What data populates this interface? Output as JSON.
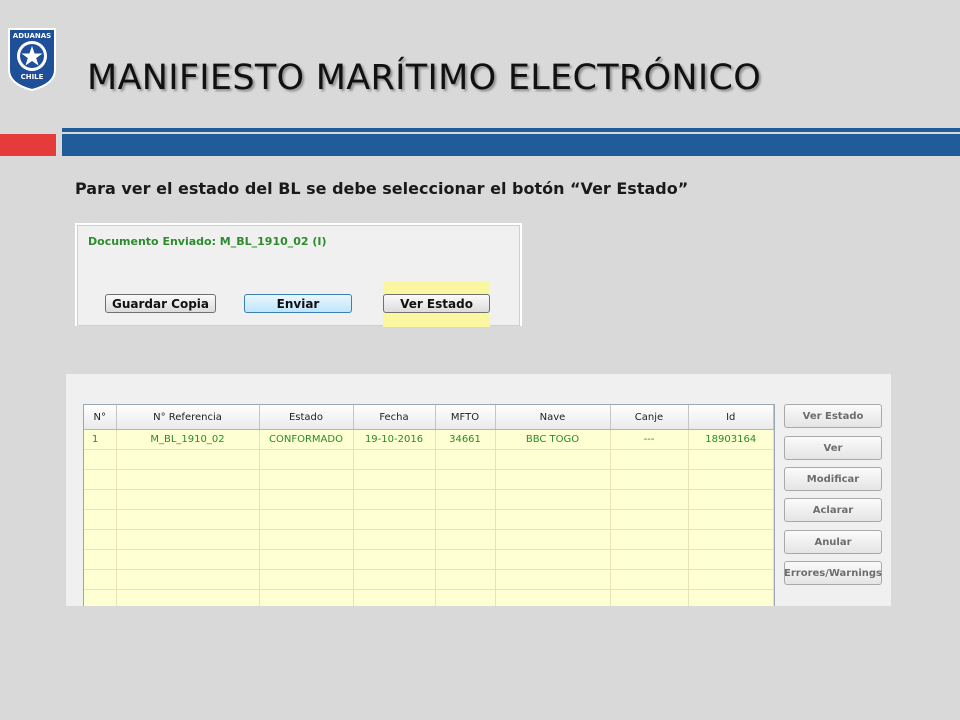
{
  "logo": {
    "top_text": "ADUANAS",
    "bottom_text": "CHILE"
  },
  "title": "MANIFIESTO MARÍTIMO ELECTRÓNICO",
  "instruction": "Para ver el estado del BL se debe seleccionar el botón “Ver Estado”",
  "colors": {
    "accent_red": "#e63b3b",
    "accent_blue": "#1f5c99",
    "highlight": "#fbf7a0",
    "row_green": "#2a8a2a"
  },
  "form": {
    "doc_label": "Documento Enviado:  M_BL_1910_02 (I)",
    "buttons": {
      "guardar": "Guardar Copia",
      "enviar": "Enviar",
      "ver_estado": "Ver Estado"
    }
  },
  "table": {
    "headers": [
      "N°",
      "N° Referencia",
      "Estado",
      "Fecha",
      "MFTO",
      "Nave",
      "Canje",
      "Id"
    ],
    "row": [
      "1",
      "M_BL_1910_02",
      "CONFORMADO",
      "19-10-2016",
      "34661",
      "BBC TOGO",
      "---",
      "18903164"
    ]
  },
  "side_buttons": [
    "Ver Estado",
    "Ver",
    "Modificar",
    "Aclarar",
    "Anular",
    "Errores/Warnings"
  ]
}
